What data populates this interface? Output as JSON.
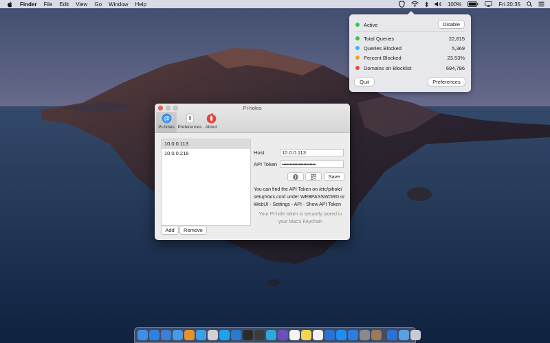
{
  "menubar": {
    "app_name": "Finder",
    "menus": [
      "File",
      "Edit",
      "View",
      "Go",
      "Window",
      "Help"
    ],
    "battery": "100%",
    "clock": "Fri 20:35",
    "icons": [
      "apple-icon",
      "pihole-status-icon",
      "wifi-icon",
      "bluetooth-icon",
      "volume-icon",
      "battery-icon",
      "airplay-icon",
      "search-icon",
      "control-icon",
      "menu-list-icon"
    ]
  },
  "popover": {
    "status": {
      "label": "Active",
      "color": "#2ecc40"
    },
    "disable_label": "Disable",
    "stats": [
      {
        "label": "Total Queries",
        "value": "22,815",
        "color": "#2ecc40"
      },
      {
        "label": "Queries Blocked",
        "value": "5,369",
        "color": "#35b6f0"
      },
      {
        "label": "Percent Blocked",
        "value": "23.53%",
        "color": "#f0a030"
      },
      {
        "label": "Domains on Blocklist",
        "value": "694,786",
        "color": "#e54b3c"
      }
    ],
    "quit_label": "Quit",
    "preferences_label": "Preferences"
  },
  "window": {
    "title": "Pi-holes",
    "toolbar": [
      {
        "label": "Pi-holes",
        "icon": "at-icon"
      },
      {
        "label": "Preferences",
        "icon": "switch-icon"
      },
      {
        "label": "About",
        "icon": "pihole-logo-icon"
      }
    ],
    "hosts": [
      "10.0.0.113",
      "10.0.0.218"
    ],
    "add_label": "Add",
    "remove_label": "Remove",
    "host_label": "Host",
    "host_value": "10.0.0.113",
    "token_label": "API Token",
    "token_value": "••••••••••••••••••••••",
    "save_label": "Save",
    "token_help": "You can find the API Token on /etc/pihole/ setupVars.conf under WEBPASSWORD or WebUI - Settings - API - Show API Token",
    "keychain_note": "Your Pi-hole token is securely stored in your Mac's Keychain"
  },
  "dock": {
    "apps": [
      {
        "name": "finder-icon",
        "color": "#3d8fe8"
      },
      {
        "name": "safari-icon",
        "color": "#2f80e0"
      },
      {
        "name": "xcode-icon",
        "color": "#3b7fd6"
      },
      {
        "name": "mail-icon",
        "color": "#4a98e8"
      },
      {
        "name": "sublime-icon",
        "color": "#e8912b"
      },
      {
        "name": "tweetbot-icon",
        "color": "#3aa0e8"
      },
      {
        "name": "pihole-app-icon",
        "color": "#d0d0d6"
      },
      {
        "name": "twitter-icon",
        "color": "#1da1f2"
      },
      {
        "name": "vscode-icon",
        "color": "#2a7ad0"
      },
      {
        "name": "terminal-icon",
        "color": "#2b2b2b"
      },
      {
        "name": "activity-monitor-icon",
        "color": "#3c3c3c"
      },
      {
        "name": "telegram-icon",
        "color": "#2ea6de"
      },
      {
        "name": "github-desktop-icon",
        "color": "#6b4fbb"
      },
      {
        "name": "calendar-icon",
        "color": "#f4f4f4"
      },
      {
        "name": "notes-icon",
        "color": "#f7d44c"
      },
      {
        "name": "music-icon",
        "color": "#f2f2f2"
      },
      {
        "name": "1password-icon",
        "color": "#2a72d6"
      },
      {
        "name": "app-store-icon",
        "color": "#1e8ef0"
      },
      {
        "name": "appstore-blue-icon",
        "color": "#2d7ee0"
      },
      {
        "name": "system-preferences-icon",
        "color": "#8a8a8e"
      },
      {
        "name": "box-icon",
        "color": "#9a7a58"
      },
      {
        "name": "1password-mini-icon",
        "color": "#2a72d6"
      },
      {
        "name": "downloads-icon",
        "color": "#5aa0e6"
      },
      {
        "name": "trash-icon",
        "color": "#c8ccd2"
      }
    ]
  }
}
